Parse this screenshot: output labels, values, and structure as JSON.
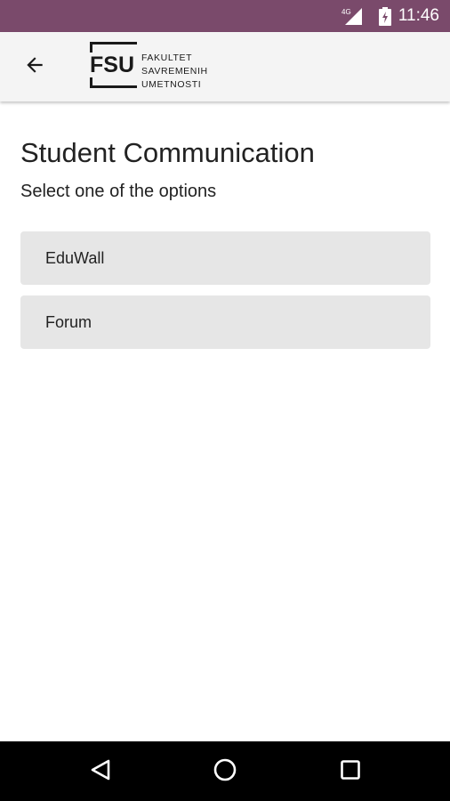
{
  "status_bar": {
    "network_label": "4G",
    "time": "11:46",
    "icons": [
      "signal-icon",
      "battery-icon"
    ]
  },
  "app_bar": {
    "back_icon": "arrow-left-icon",
    "logo": {
      "abbr": "FSU",
      "lines": [
        "FAKULTET",
        "SAVREMENIH",
        "UMETNOSTI"
      ]
    }
  },
  "page": {
    "title": "Student Communication",
    "subtitle": "Select one of the options",
    "options": [
      {
        "label": "EduWall"
      },
      {
        "label": "Forum"
      }
    ]
  },
  "nav_bar": {
    "icons": [
      "back-triangle-icon",
      "home-circle-icon",
      "recents-square-icon"
    ]
  },
  "colors": {
    "status_bar": "#7a4a6b",
    "app_bar": "#f4f4f4",
    "option_bg": "#e6e6e6",
    "nav_bar": "#000000"
  }
}
